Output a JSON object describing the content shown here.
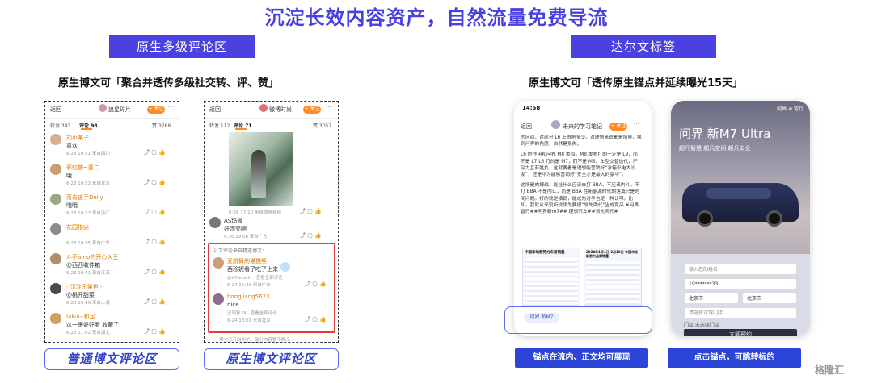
{
  "headline": "沉淀长效内容资产，自然流量免费导流",
  "left_section": {
    "pill": "原生多级评论区",
    "subtitle": "原生博文可「聚合并透传多级社交转、评、赞」",
    "phone1": {
      "back": "返回",
      "account": "追星碎片",
      "follow": "+ 关注",
      "tabs": [
        "转发 343",
        "评论 98",
        "赞 3768"
      ],
      "comments": [
        {
          "name": "刘小某子",
          "text": "喜欢 ",
          "meta": "6-23 10:21 来自四川"
        },
        {
          "name": "彩虹糖~酱二",
          "text": "哦",
          "meta": "6-23 10:22 来自北京"
        },
        {
          "name": "落去追手Deily",
          "text": "哦哦",
          "meta": "6-23 10:27 来自浙江"
        },
        {
          "name": "花园指尖",
          "text": "",
          "meta": "6-23 10:35 来自广东"
        },
        {
          "name": "斗不amo的开心大王",
          "text": "@西西收件箱",
          "meta": "6-23 10:41 来自江苏"
        },
        {
          "name": "- 沉淀子果色 -",
          "text": "@桃开甜菜",
          "meta": "6-23 10:49 来自上海"
        },
        {
          "name": "Iakui--和足",
          "text": "这一眼好好看 收藏了",
          "meta": "6-23 11:02 来自湖北"
        }
      ],
      "caption": "普通博文评论区"
    },
    "phone2": {
      "back": "返回",
      "account": "微博时尚",
      "follow": "+ 关注",
      "tabs": [
        "转发 112",
        "评论 71",
        "赞 3057"
      ],
      "image_meta": "6-26 17:10 来自微博视频",
      "comment1": {
        "name": "AS玛微",
        "text": "好漂亮啊",
        "meta": "6-26 19:06 来自广东"
      },
      "box_title": "以下评论来自精选博文：",
      "box_comments": [
        {
          "name": "爱跳舞的猫猫熊",
          "text": "西珍妮看了吃了上来",
          "meta": "6-24 15:46 来自广东"
        },
        {
          "name": "hongjiang5623",
          "text": "nice",
          "meta": "6-24 18:01 来自北京"
        }
      ],
      "reply_hint": "@#Farrelih · 查看全部评论",
      "reply_hint2": "已回复29 · 查看全部评论",
      "footer": "博主已开启防护，部分内容暂不展示",
      "caption": "原生博文评论区"
    }
  },
  "right_section": {
    "pill": "达尔文标签",
    "subtitle": "原生博文可「透传原生锚点并延续曝光15天」",
    "phone3": {
      "time": "14:58",
      "back": "返回",
      "account": "未来的学习笔记",
      "follow": "+ 关注",
      "paragraphs": [
        "的区间，这部分 L6 上市抢多少。对理想来说都是增量，换到问界的角度，自然是损失。",
        "L6 的作用和问界 M8 类似，M8 发布打的一定是 L9，而不是 L7 L6 打的是 M7，而不是 M5。车型交替迭代，产品力互有胜负，这就要看是理想能营销好“冰箱彩电大沙发”，还是华为能够营销好“安全才是最大的豪华”。",
        "这场是肉搏战，能扯什么应该去打 BBA，不应该内斗。不打 BBA 不是内讧，而是 BBA 在新能源时代的落寞只是时间问题。打的就是横销，能成为对手也是一种认可。比如，我就从来没听说华为要把“领先两代”当成竞品 #问界智行##问界新m7## 理想汽车##领先两代#"
      ],
      "table_title_left": "中国市场新势力车型销量",
      "table_title_right": "2024年1月1日-2月18日 中国市场新势力品牌销量",
      "anchor": "问界 新M7",
      "caption": "锚点在流内、正文均可展现"
    },
    "phone4": {
      "brand": "问界 新M7 Ultra",
      "slogan": "超凡智慧 超凡空间 超凡安全",
      "top_right": "问界 ⊕ 智行",
      "fields": [
        "输入您的姓名",
        "19*******33",
        "北京市",
        "北京市",
        "请选择试驾门店",
        "门店  未选择门店"
      ],
      "cta": "立即预约",
      "caption": "点击锚点，可跳转标的"
    }
  },
  "watermark": "格隆汇"
}
